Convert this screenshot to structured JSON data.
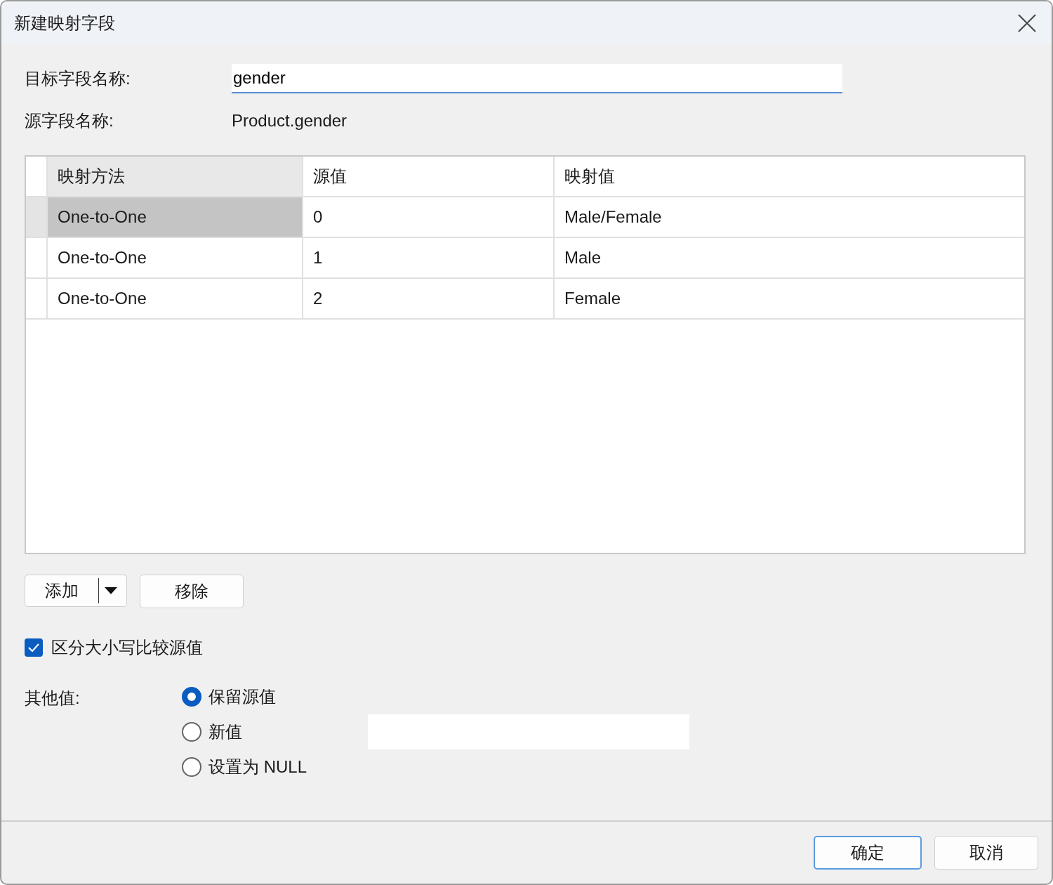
{
  "window": {
    "title": "新建映射字段"
  },
  "target_field": {
    "label": "目标字段名称:",
    "value": "gender"
  },
  "source_field": {
    "label": "源字段名称:",
    "value": "Product.gender"
  },
  "table": {
    "columns": [
      "映射方法",
      "源值",
      "映射值"
    ],
    "rows": [
      {
        "method": "One-to-One",
        "source": "0",
        "mapped": "Male/Female",
        "selected": true
      },
      {
        "method": "One-to-One",
        "source": "1",
        "mapped": "Male",
        "selected": false
      },
      {
        "method": "One-to-One",
        "source": "2",
        "mapped": "Female",
        "selected": false
      }
    ]
  },
  "table_buttons": {
    "add": "添加",
    "remove": "移除"
  },
  "case_sensitive": {
    "label": "区分大小写比较源值",
    "checked": true
  },
  "other_values": {
    "label": "其他值:",
    "options": [
      {
        "label": "保留源值",
        "selected": true
      },
      {
        "label": "新值",
        "selected": false
      },
      {
        "label": "设置为 NULL",
        "selected": false
      }
    ]
  },
  "buttons": [
    {
      "label": "确定",
      "default": true
    },
    {
      "label": "取消",
      "default": false
    }
  ]
}
